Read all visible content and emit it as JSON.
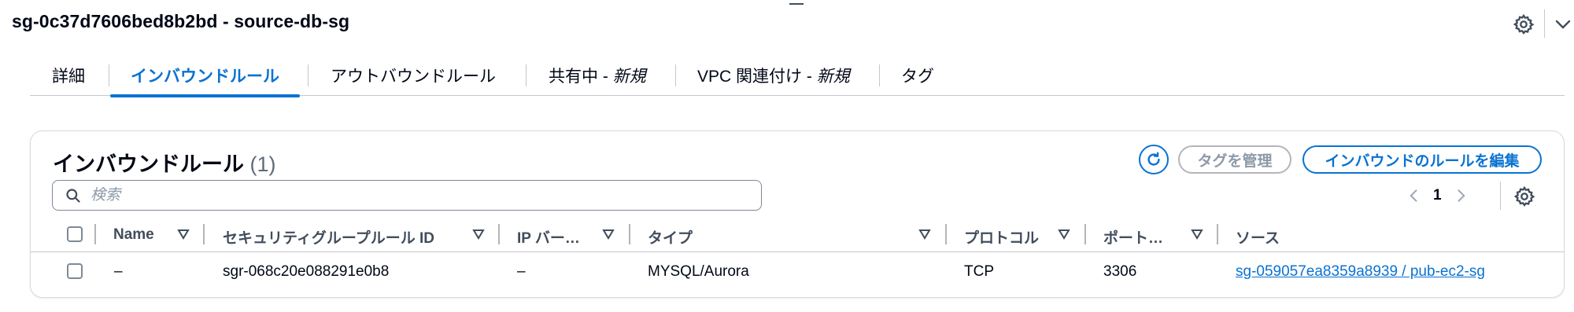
{
  "page": {
    "title": "sg-0c37d7606bed8b2bd - source-db-sg"
  },
  "tabs": [
    {
      "label": "詳細",
      "badge": ""
    },
    {
      "label": "インバウンドルール",
      "badge": "",
      "active": true
    },
    {
      "label": "アウトバウンドルール",
      "badge": ""
    },
    {
      "label": "共有中 - ",
      "badge": "新規"
    },
    {
      "label": "VPC 関連付け - ",
      "badge": "新規"
    },
    {
      "label": "タグ",
      "badge": ""
    }
  ],
  "section": {
    "title": "インバウンドルール",
    "count": "(1)",
    "manage_tags_label": "タグを管理",
    "edit_rules_label": "インバウンドのルールを編集",
    "search_placeholder": "検索",
    "search_value": "",
    "current_page": "1"
  },
  "table": {
    "columns": [
      "Name",
      "セキュリティグループルール ID",
      "IP バー…",
      "タイプ",
      "プロトコル",
      "ポート…",
      "ソース"
    ],
    "rows": [
      {
        "name": "–",
        "rule_id": "sgr-068c20e088291e0b8",
        "ip_version": "–",
        "type": "MYSQL/Aurora",
        "protocol": "TCP",
        "port": "3306",
        "source": "sg-059057ea8359a8939 / pub-ec2-sg"
      }
    ]
  },
  "colors": {
    "accent": "#0972d3",
    "text": "#000716",
    "muted": "#5f6b7a",
    "border": "#c6c6cd"
  },
  "icons": [
    "gear-icon",
    "chevron-down-icon",
    "refresh-icon",
    "search-icon",
    "chevron-left-icon",
    "chevron-right-icon",
    "sort-caret-icon"
  ]
}
